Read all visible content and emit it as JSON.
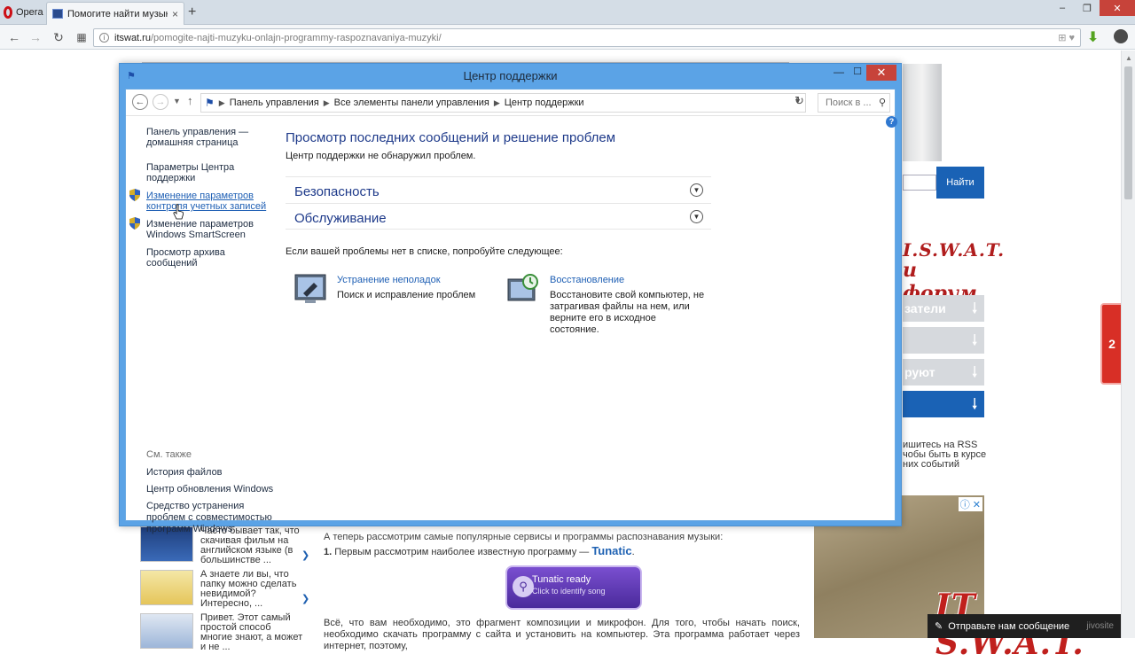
{
  "browser": {
    "menu_label": "Opera",
    "tab_title": "Помогите найти музык...",
    "tab_close": "×",
    "new_tab": "+",
    "url_host": "itswat.ru",
    "url_path": "/pomogite-najti-muzyku-onlajn-programmy-raspoznavaniya-muzyki/",
    "url_right_icons": "⊞ ♥",
    "download_icon": "download-arrow-icon",
    "win_min": "–",
    "win_max": "❐",
    "win_close": "✕"
  },
  "site": {
    "search_button": "Найти",
    "logo_line1": "I.S.W.A.T.",
    "logo_line2": "и форум",
    "sidebar_tabs": [
      "затели",
      "",
      "руют",
      ""
    ],
    "rss_text": "ишитесь на RSS\nчобы быть в курсе\nних событий",
    "feedback_tab": "2",
    "ad_close": "ⓘ ✕",
    "watermark": "IT S.W.A.T.",
    "jivosite_label": "Отправьте нам сообщение",
    "jivosite_brand": "jivosite",
    "articles": [
      {
        "text": "Часто бывает так, что скачивая фильм на английском языке (в большинстве ..."
      },
      {
        "text": "А знаете ли вы, что папку можно сделать невидимой? Интересно, ..."
      },
      {
        "text": "Привет. Этот самый простой способ многие знают, а может и не ..."
      }
    ],
    "article_p1": "А теперь рассмотрим самые популярные сервисы и программы распознавания музыки:",
    "article_l2_num": "1.",
    "article_l2_text": " Первым рассмотрим наиболее известную программу — ",
    "article_l2_link": "Tunatic",
    "article_l2_dot": ".",
    "tunatic_t1": "Tunatic ready",
    "tunatic_t2": "Click to identify song",
    "article_p2": "Всё, что вам необходимо, это фрагмент композиции и микрофон. Для того, чтобы начать поиск, необходимо скачать программу с сайта и установить на компьютер. Эта программа работает через интернет, поэтому,"
  },
  "window": {
    "title": "Центр поддержки",
    "btn_min": "—",
    "btn_max": "☐",
    "btn_close": "✕",
    "breadcrumbs": [
      "Панель управления",
      "Все элементы панели управления",
      "Центр поддержки"
    ],
    "search_placeholder": "Поиск в ...",
    "help": "?",
    "left_links": {
      "home": "Панель управления —\nдомашняя страница",
      "settings": "Параметры Центра\nподдержки",
      "uac": "Изменение параметров\nконтроля учетных записей",
      "smartscreen": "Изменение параметров\nWindows SmartScreen",
      "archive": "Просмотр архива сообщений"
    },
    "see_also": {
      "title": "См. также",
      "file_history": "История файлов",
      "windows_update": "Центр обновления Windows",
      "compat": "Средство устранения\nпроблем с совместимостью\nпрограмм Windows"
    },
    "main": {
      "heading": "Просмотр последних сообщений и решение проблем",
      "status": "Центр поддержки не обнаружил проблем.",
      "sections": [
        "Безопасность",
        "Обслуживание"
      ],
      "hint": "Если вашей проблемы нет в списке, попробуйте следующее:",
      "tiles": [
        {
          "title": "Устранение неполадок",
          "desc": "Поиск и исправление проблем",
          "icon": "troubleshoot-icon"
        },
        {
          "title": "Восстановление",
          "desc": "Восстановите свой компьютер, не затрагивая файлы на нем, или верните его в исходное состояние.",
          "icon": "recovery-icon"
        }
      ]
    }
  }
}
